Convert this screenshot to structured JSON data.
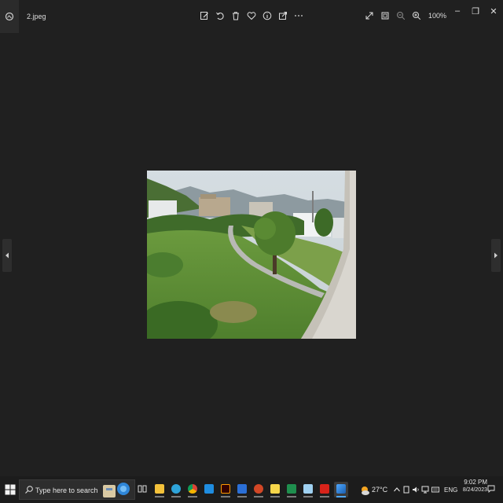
{
  "window": {
    "file_name": "2.jpeg",
    "zoom_level": "100%"
  },
  "toolbar": {
    "icons": [
      "edit-icon",
      "rotate-icon",
      "delete-icon",
      "favorite-icon",
      "info-icon",
      "share-icon",
      "more-icon"
    ],
    "right_icons": [
      "expand-icon",
      "fit-icon",
      "zoom-out-icon",
      "zoom-in-icon"
    ]
  },
  "window_controls": {
    "minimize": "–",
    "maximize": "❐",
    "close": "✕"
  },
  "taskbar": {
    "search_placeholder": "Type here to search",
    "weather": "27°C",
    "language": "ENG",
    "time": "9:02 PM",
    "date": "8/24/2023",
    "apps": [
      "task-view",
      "file-explorer",
      "edge",
      "chrome",
      "mail",
      "illustrator",
      "word",
      "powerpoint",
      "sticky-notes",
      "excel",
      "notepad",
      "acrobat",
      "photos"
    ]
  },
  "colors": {
    "background": "#202020",
    "taskbar": "#1c1c1c",
    "accent": "#4fa8ff"
  }
}
